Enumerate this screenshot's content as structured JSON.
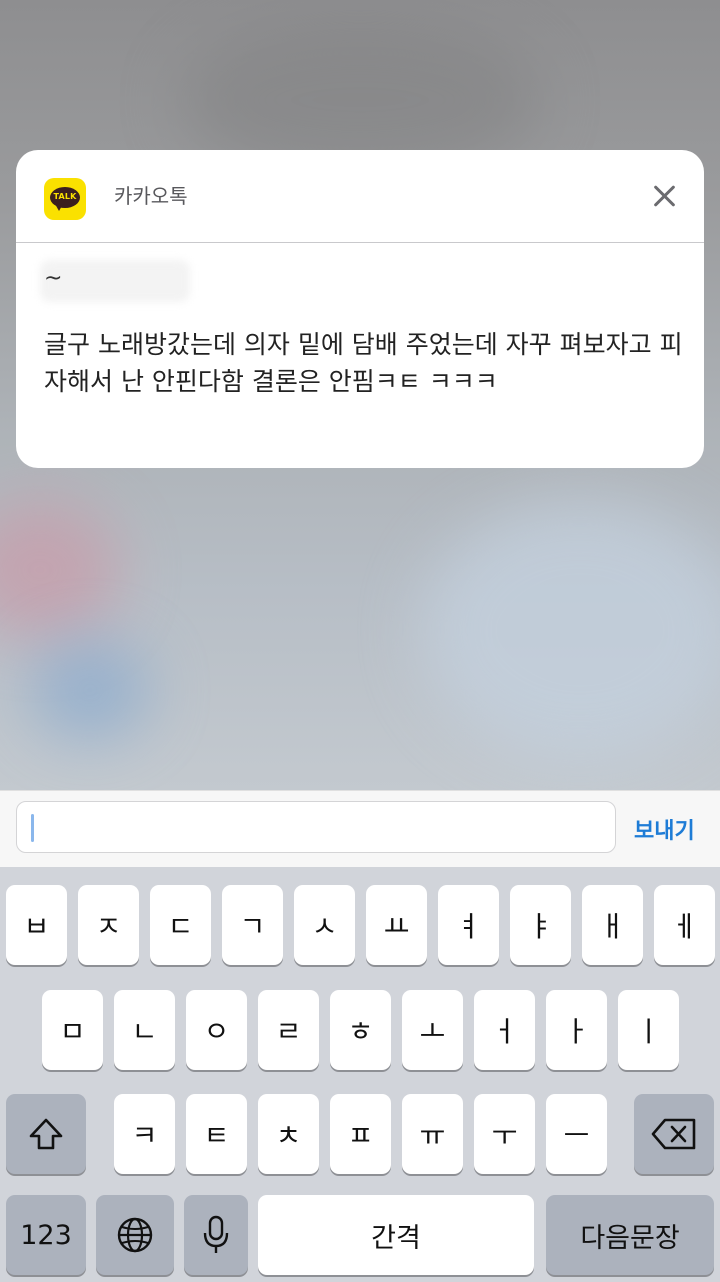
{
  "notification": {
    "app_name": "카카오톡",
    "app_icon_text": "TALK",
    "sender_visible": "~",
    "message": "글구 노래방갔는데 의자 밑에 담배 주었는데 자꾸 펴보자고 피자해서 난 안핀다함 결론은 안핌ㅋㅌ ㅋㅋㅋ"
  },
  "input_bar": {
    "placeholder": "",
    "send_label": "보내기"
  },
  "keyboard": {
    "row1": [
      "ㅂ",
      "ㅈ",
      "ㄷ",
      "ㄱ",
      "ㅅ",
      "ㅛ",
      "ㅕ",
      "ㅑ",
      "ㅐ",
      "ㅔ"
    ],
    "row2": [
      "ㅁ",
      "ㄴ",
      "ㅇ",
      "ㄹ",
      "ㅎ",
      "ㅗ",
      "ㅓ",
      "ㅏ",
      "ㅣ"
    ],
    "row3": [
      "ㅋ",
      "ㅌ",
      "ㅊ",
      "ㅍ",
      "ㅠ",
      "ㅜ",
      "ㅡ"
    ],
    "numbers_label": "123",
    "space_label": "간격",
    "return_label": "다음문장",
    "icons": [
      "shift-icon",
      "backspace-icon",
      "globe-icon",
      "microphone-icon"
    ]
  },
  "colors": {
    "accent": "#1e7cd6",
    "kakao_yellow": "#fae100",
    "keyboard_bg": "#d1d4da"
  }
}
